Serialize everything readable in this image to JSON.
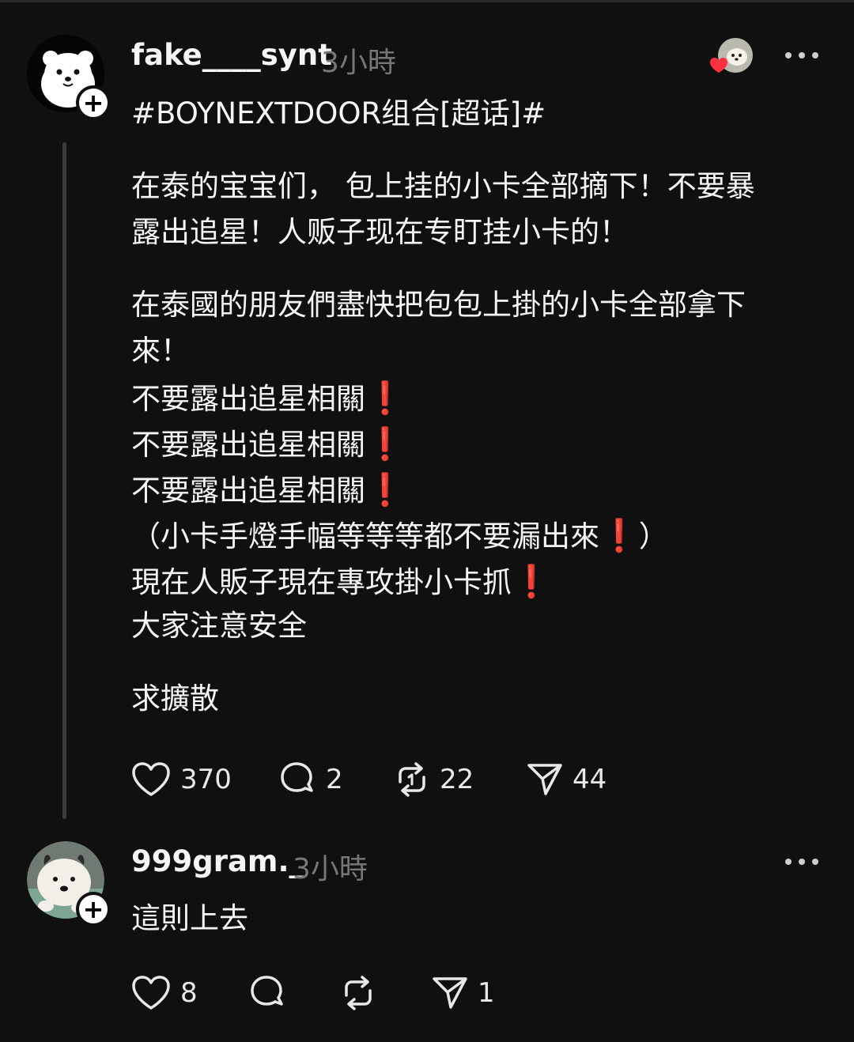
{
  "colors": {
    "background": "#101010",
    "text": "#f3f5f7",
    "muted": "#777777",
    "alert_red": "#e3262e",
    "heart_red": "#ff3040"
  },
  "post": {
    "author": {
      "username": "fake____synt",
      "time": "3小時",
      "avatar_icon": "polar-bear-avatar-icon",
      "follow_icon": "plus-icon"
    },
    "liked_by_icon": "liked-avatar-with-heart-icon",
    "more_icon": "more-dots-icon",
    "hashtag": "#BOYNEXTDOOR组合[超话]#",
    "lines": [
      "在泰的宝宝们， 包上挂的小卡全部摘下！不要暴",
      "露出追星！人贩子现在专盯挂小卡的！",
      "在泰國的朋友們盡快把包包上掛的小卡全部拿下",
      "來！",
      "不要露出追星相關",
      "不要露出追星相關",
      "不要露出追星相關",
      "（小卡手燈手幅等等等都不要漏出來",
      "）",
      "現在人販子現在專攻掛小卡抓",
      "大家注意安全",
      "求擴散"
    ],
    "exclamation": "❗",
    "actions": {
      "likes": "370",
      "comments": "2",
      "reposts": "22",
      "shares": "44"
    }
  },
  "reply": {
    "author": {
      "username": "999gram._",
      "time": "3小時",
      "avatar_icon": "puppy-avatar-icon",
      "follow_icon": "plus-icon"
    },
    "more_icon": "more-dots-icon",
    "text": "這則上去",
    "actions": {
      "likes": "8",
      "comments": "",
      "reposts": "",
      "shares": "1"
    }
  }
}
